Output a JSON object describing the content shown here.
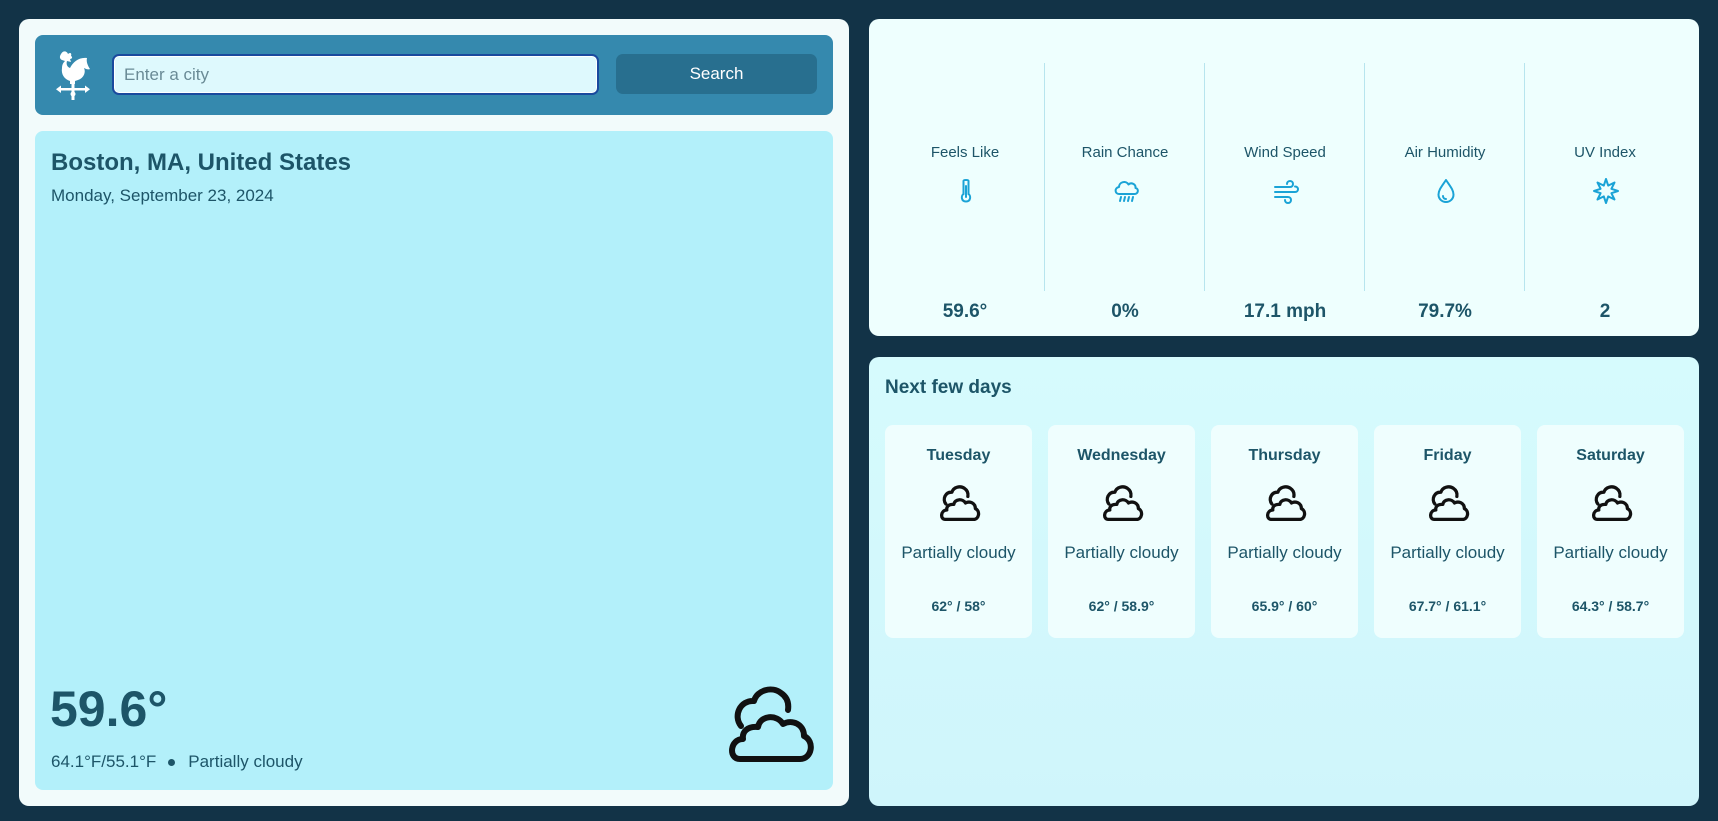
{
  "header": {
    "logo_icon": "weather-vane-rooster-icon",
    "search_placeholder": "Enter a city",
    "search_value": "",
    "search_button_label": "Search"
  },
  "current": {
    "location": "Boston, MA, United States",
    "date": "Monday, September 23, 2024",
    "temperature": "59.6°",
    "hi_lo": "64.1°F/55.1°F",
    "condition": "Partially cloudy",
    "condition_icon": "partly-cloudy-icon"
  },
  "stats": [
    {
      "label": "Feels Like",
      "value": "59.6°",
      "icon": "thermometer-icon"
    },
    {
      "label": "Rain Chance",
      "value": "0%",
      "icon": "rain-cloud-icon"
    },
    {
      "label": "Wind Speed",
      "value": "17.1 mph",
      "icon": "wind-icon"
    },
    {
      "label": "Air Humidity",
      "value": "79.7%",
      "icon": "droplet-icon"
    },
    {
      "label": "UV Index",
      "value": "2",
      "icon": "sun-icon"
    }
  ],
  "forecast": {
    "title": "Next few days",
    "days": [
      {
        "day": "Tuesday",
        "condition": "Partially cloudy",
        "temps": "62° / 58°"
      },
      {
        "day": "Wednesday",
        "condition": "Partially cloudy",
        "temps": "62° / 58.9°"
      },
      {
        "day": "Thursday",
        "condition": "Partially cloudy",
        "temps": "65.9° / 60°"
      },
      {
        "day": "Friday",
        "condition": "Partially cloudy",
        "temps": "67.7° / 61.1°"
      },
      {
        "day": "Saturday",
        "condition": "Partially cloudy",
        "temps": "64.3° / 58.7°"
      }
    ]
  },
  "colors": {
    "page_background": "#123347",
    "header_bar": "#3589ae",
    "search_button": "#286f8f",
    "current_card": "#b3f0fa",
    "text_primary": "#1d5568",
    "stat_icon": "#1aa3d6"
  }
}
